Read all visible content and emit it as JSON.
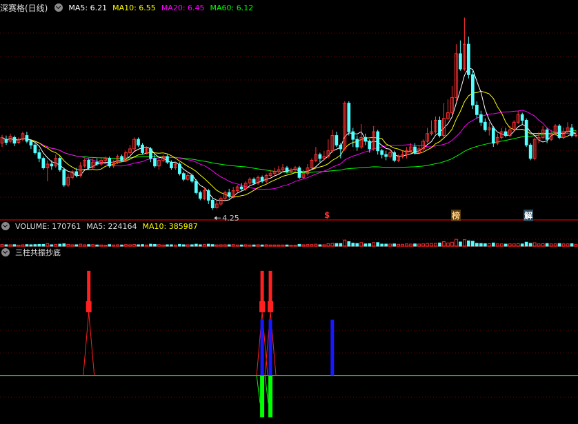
{
  "header": {
    "stock_name": "深赛格(日线)",
    "ma5": "MA5: 6.21",
    "ma10": "MA10: 6.55",
    "ma20": "MA20: 6.45",
    "ma60": "MA60: 6.12",
    "low_label": "4.25"
  },
  "volume_header": {
    "volume": "VOLUME: 170761",
    "ma5": "MA5: 224164",
    "ma10": "MA10: 385987"
  },
  "indicator_header": {
    "title": "三柱共振抄底"
  },
  "markers": {
    "s": "$",
    "bang": "榜",
    "jie": "解"
  },
  "colors": {
    "up": "#ff3232",
    "down": "#54ffff",
    "ma5": "#ffffff",
    "ma10": "#ffff00",
    "ma20": "#ff00ff",
    "ma60": "#00ff00",
    "grid": "#7a0000",
    "sep": "#b00000",
    "ind_red": "#ff2020",
    "ind_blue": "#1818ff",
    "ind_green": "#00ff00"
  },
  "chart_data": {
    "type": "candlestick",
    "price_axis": [
      4.0,
      9.4
    ],
    "n_bars": 140,
    "candles": [
      [
        6.0,
        6.15,
        6.22,
        5.9
      ],
      [
        6.1,
        6.02,
        6.2,
        5.95
      ],
      [
        6.05,
        6.18,
        6.25,
        6.0
      ],
      [
        6.15,
        6.0,
        6.2,
        5.92
      ],
      [
        6.02,
        6.1,
        6.15,
        5.98
      ],
      [
        6.1,
        6.25,
        6.3,
        6.05
      ],
      [
        6.2,
        6.05,
        6.3,
        6.0
      ],
      [
        6.05,
        5.95,
        6.1,
        5.85
      ],
      [
        5.95,
        5.75,
        6.0,
        5.7
      ],
      [
        5.75,
        5.6,
        5.85,
        5.5
      ],
      [
        5.6,
        5.35,
        5.65,
        5.3
      ],
      [
        5.35,
        5.45,
        5.55,
        5.0
      ],
      [
        5.45,
        5.4,
        5.55,
        5.3
      ],
      [
        5.4,
        5.6,
        5.7,
        5.35
      ],
      [
        5.6,
        5.3,
        5.65,
        5.25
      ],
      [
        5.3,
        4.9,
        5.35,
        4.85
      ],
      [
        4.9,
        5.1,
        5.2,
        4.85
      ],
      [
        5.1,
        5.25,
        5.3,
        5.05
      ],
      [
        5.25,
        5.15,
        5.35,
        5.1
      ],
      [
        5.15,
        5.4,
        5.5,
        5.1
      ],
      [
        5.4,
        5.55,
        5.6,
        5.35
      ],
      [
        5.55,
        5.35,
        5.6,
        5.3
      ],
      [
        5.35,
        5.5,
        5.6,
        5.3
      ],
      [
        5.5,
        5.45,
        5.6,
        5.4
      ],
      [
        5.45,
        5.55,
        5.6,
        5.4
      ],
      [
        5.55,
        5.6,
        5.65,
        5.5
      ],
      [
        5.6,
        5.4,
        5.65,
        5.35
      ],
      [
        5.4,
        5.5,
        5.55,
        5.35
      ],
      [
        5.5,
        5.65,
        5.7,
        5.45
      ],
      [
        5.65,
        5.55,
        5.7,
        5.5
      ],
      [
        5.55,
        5.75,
        5.8,
        5.5
      ],
      [
        5.75,
        5.85,
        5.95,
        5.7
      ],
      [
        5.85,
        6.1,
        6.15,
        5.8
      ],
      [
        6.1,
        5.95,
        6.15,
        5.9
      ],
      [
        5.95,
        5.75,
        6.0,
        5.7
      ],
      [
        5.75,
        5.85,
        5.9,
        5.7
      ],
      [
        5.85,
        5.6,
        5.9,
        5.5
      ],
      [
        5.6,
        5.4,
        5.7,
        5.35
      ],
      [
        5.4,
        5.55,
        5.6,
        5.3
      ],
      [
        5.55,
        5.65,
        5.7,
        5.5
      ],
      [
        5.65,
        5.5,
        5.7,
        5.45
      ],
      [
        5.5,
        5.35,
        5.55,
        5.3
      ],
      [
        5.35,
        5.45,
        5.5,
        5.3
      ],
      [
        5.45,
        5.2,
        5.5,
        5.15
      ],
      [
        5.2,
        5.05,
        5.25,
        5.0
      ],
      [
        5.05,
        5.15,
        5.25,
        5.0
      ],
      [
        5.15,
        5.0,
        5.2,
        4.95
      ],
      [
        5.0,
        4.7,
        5.05,
        4.65
      ],
      [
        4.7,
        4.55,
        4.75,
        4.5
      ],
      [
        4.55,
        4.75,
        4.85,
        4.5
      ],
      [
        4.75,
        4.5,
        4.8,
        4.4
      ],
      [
        4.5,
        4.3,
        4.55,
        4.25
      ],
      [
        4.3,
        4.4,
        4.5,
        4.28
      ],
      [
        4.4,
        4.55,
        4.6,
        4.35
      ],
      [
        4.55,
        4.7,
        4.75,
        4.5
      ],
      [
        4.7,
        4.6,
        4.8,
        4.55
      ],
      [
        4.6,
        4.75,
        4.85,
        4.55
      ],
      [
        4.75,
        4.85,
        4.9,
        4.7
      ],
      [
        4.85,
        4.8,
        4.95,
        4.75
      ],
      [
        4.8,
        4.95,
        5.0,
        4.75
      ],
      [
        4.95,
        5.05,
        5.1,
        4.9
      ],
      [
        5.05,
        4.95,
        5.1,
        4.9
      ],
      [
        4.95,
        5.1,
        5.15,
        4.9
      ],
      [
        5.1,
        5.0,
        5.15,
        4.95
      ],
      [
        5.0,
        5.15,
        5.2,
        4.95
      ],
      [
        5.15,
        5.2,
        5.3,
        5.1
      ],
      [
        5.2,
        5.25,
        5.35,
        5.15
      ],
      [
        5.25,
        5.3,
        5.4,
        5.2
      ],
      [
        5.3,
        5.35,
        5.45,
        5.25
      ],
      [
        5.35,
        5.25,
        5.4,
        5.2
      ],
      [
        5.25,
        5.3,
        5.35,
        5.2
      ],
      [
        5.3,
        5.35,
        5.4,
        5.25
      ],
      [
        5.35,
        5.1,
        5.4,
        5.05
      ],
      [
        5.1,
        5.2,
        5.3,
        5.05
      ],
      [
        5.2,
        5.35,
        5.45,
        5.15
      ],
      [
        5.35,
        5.55,
        5.6,
        5.3
      ],
      [
        5.55,
        5.7,
        5.9,
        5.5
      ],
      [
        5.7,
        5.6,
        5.75,
        5.5
      ],
      [
        5.6,
        5.65,
        5.8,
        5.55
      ],
      [
        5.65,
        5.8,
        6.1,
        5.6
      ],
      [
        5.8,
        6.2,
        6.35,
        5.75
      ],
      [
        6.2,
        5.95,
        6.3,
        5.9
      ],
      [
        5.95,
        5.85,
        6.0,
        5.6
      ],
      [
        5.85,
        7.05,
        7.1,
        5.8
      ],
      [
        7.05,
        6.3,
        7.1,
        6.2
      ],
      [
        6.3,
        6.1,
        6.4,
        5.9
      ],
      [
        6.1,
        5.9,
        6.2,
        5.8
      ],
      [
        5.9,
        6.15,
        6.5,
        5.85
      ],
      [
        6.15,
        6.05,
        6.25,
        5.95
      ],
      [
        6.05,
        5.85,
        6.1,
        5.75
      ],
      [
        5.85,
        6.3,
        6.45,
        5.8
      ],
      [
        6.3,
        5.8,
        6.35,
        5.7
      ],
      [
        5.8,
        5.7,
        5.85,
        5.6
      ],
      [
        5.7,
        5.65,
        5.8,
        5.55
      ],
      [
        5.65,
        5.75,
        5.85,
        5.6
      ],
      [
        5.75,
        5.55,
        5.8,
        5.5
      ],
      [
        5.55,
        5.65,
        5.7,
        5.5
      ],
      [
        5.65,
        5.7,
        5.8,
        5.6
      ],
      [
        5.7,
        5.8,
        5.9,
        5.6
      ],
      [
        5.8,
        5.9,
        6.0,
        5.75
      ],
      [
        5.9,
        5.75,
        6.0,
        5.7
      ],
      [
        5.75,
        5.85,
        5.95,
        5.7
      ],
      [
        5.85,
        6.05,
        6.1,
        5.8
      ],
      [
        6.05,
        6.25,
        6.4,
        6.0
      ],
      [
        6.25,
        6.3,
        6.6,
        6.2
      ],
      [
        6.3,
        6.6,
        6.7,
        6.25
      ],
      [
        6.6,
        6.2,
        6.7,
        6.15
      ],
      [
        6.2,
        6.65,
        7.05,
        6.15
      ],
      [
        6.65,
        6.8,
        7.15,
        6.6
      ],
      [
        6.8,
        7.2,
        7.5,
        6.75
      ],
      [
        7.2,
        8.35,
        8.6,
        7.1
      ],
      [
        8.35,
        7.95,
        8.7,
        7.9
      ],
      [
        7.95,
        8.6,
        9.3,
        7.9
      ],
      [
        8.6,
        7.8,
        8.8,
        7.7
      ],
      [
        7.8,
        7.0,
        7.9,
        6.9
      ],
      [
        7.0,
        6.75,
        7.1,
        6.65
      ],
      [
        6.75,
        6.55,
        6.85,
        6.45
      ],
      [
        6.55,
        6.35,
        6.65,
        6.3
      ],
      [
        6.35,
        6.4,
        6.55,
        6.2
      ],
      [
        6.4,
        6.0,
        6.45,
        5.9
      ],
      [
        6.0,
        6.15,
        6.25,
        5.95
      ],
      [
        6.15,
        6.3,
        6.4,
        6.1
      ],
      [
        6.3,
        6.2,
        6.4,
        6.15
      ],
      [
        6.2,
        6.35,
        6.45,
        6.15
      ],
      [
        6.35,
        6.55,
        6.6,
        6.3
      ],
      [
        6.55,
        6.75,
        6.85,
        6.5
      ],
      [
        6.75,
        6.6,
        6.8,
        6.5
      ],
      [
        6.6,
        5.95,
        6.65,
        5.9
      ],
      [
        5.95,
        5.6,
        6.0,
        5.55
      ],
      [
        5.6,
        6.1,
        6.15,
        5.55
      ],
      [
        6.1,
        6.15,
        6.3,
        6.0
      ],
      [
        6.15,
        6.35,
        6.45,
        6.1
      ],
      [
        6.35,
        6.1,
        6.4,
        6.0
      ],
      [
        6.1,
        6.25,
        6.35,
        6.05
      ],
      [
        6.25,
        6.45,
        6.5,
        6.2
      ],
      [
        6.45,
        6.15,
        6.5,
        6.1
      ],
      [
        6.15,
        6.3,
        6.4,
        6.1
      ],
      [
        6.3,
        6.4,
        6.55,
        6.25
      ],
      [
        6.4,
        6.2,
        6.5,
        6.15
      ],
      [
        6.2,
        6.21,
        6.35,
        6.15
      ]
    ],
    "volume_axis": [
      0,
      2400000
    ],
    "low_marker_index": 51,
    "marker_indices": {
      "s": 70,
      "bang": 123,
      "jie": 143
    },
    "indicator_axis": [
      -4,
      10
    ],
    "indicator_events": [
      {
        "i": 21,
        "red": 9.0,
        "blue": 0,
        "green": 0
      },
      {
        "i": 63,
        "red": 9.0,
        "blue": 4.8,
        "green": -3.6
      },
      {
        "i": 65,
        "red": 9.0,
        "blue": 4.8,
        "green": -3.6
      },
      {
        "i": 80,
        "red": 0,
        "blue": 4.8,
        "green": 0
      }
    ]
  }
}
